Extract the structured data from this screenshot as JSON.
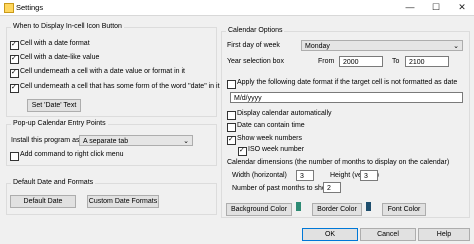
{
  "window": {
    "title": "Settings",
    "minimize": "—",
    "maximize": "☐",
    "close": "✕"
  },
  "icon_button_group": {
    "title": "When to Display In-cell Icon Button",
    "options": [
      {
        "label": "Cell with a date format",
        "checked": true
      },
      {
        "label": "Cell with a date-like value",
        "checked": true
      },
      {
        "label": "Cell underneath a cell with a date value or format in it",
        "checked": true
      },
      {
        "label": "Cell underneath a cell that has some form of the word \"date\" in it",
        "checked": true
      }
    ],
    "set_date_text_button": "Set 'Date' Text"
  },
  "popup_group": {
    "title": "Pop-up Calendar Entry Points",
    "install_label": "Install this program as",
    "install_value": "A separate tab",
    "add_command_label": "Add command to right click menu",
    "add_command_checked": false
  },
  "default_group": {
    "title": "Default Date and Formats",
    "default_date_button": "Default Date",
    "custom_formats_button": "Custom Date Formats"
  },
  "calendar_group": {
    "title": "Calendar Options",
    "first_day_label": "First day of week",
    "first_day_value": "Monday",
    "year_box_label": "Year selection box",
    "from_label": "From",
    "from_value": "2000",
    "to_label": "To",
    "to_value": "2100",
    "apply_format_label": "Apply the following date format if the target cell is not formatted as date",
    "apply_format_checked": false,
    "date_format_value": "M/d/yyyy",
    "display_auto_label": "Display calendar automatically",
    "display_auto_checked": false,
    "date_time_label": "Date can contain time",
    "date_time_checked": false,
    "week_numbers_label": "Show week numbers",
    "week_numbers_checked": true,
    "iso_label": "ISO week number",
    "iso_checked": true,
    "dimensions_label": "Calendar dimensions (the number of months to display on the calendar)",
    "width_label": "Width (horizontal)",
    "width_value": "3",
    "height_label": "Height (vertical)",
    "height_value": "3",
    "past_months_label": "Number of past months to show",
    "past_months_value": "2",
    "background_color_button": "Background Color",
    "border_color_button": "Border Color",
    "font_color_button": "Font Color",
    "background_swatch": "#2e8b74",
    "border_swatch": "#1f4f6e"
  },
  "footer": {
    "ok": "OK",
    "cancel": "Cancel",
    "help": "Help"
  }
}
